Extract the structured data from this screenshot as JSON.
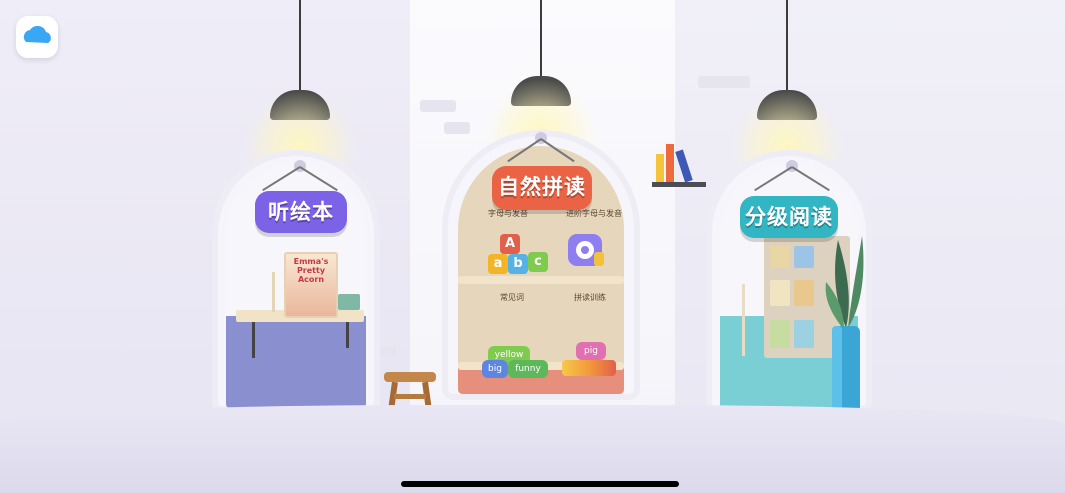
{
  "app_logo": {
    "icon": "cloud-icon",
    "color": "#3aa7f5"
  },
  "rooms": [
    {
      "sign_label": "听绘本",
      "sign_color": "#7c62e6",
      "floor_color": "#8a8fcf",
      "book": {
        "title": "Emma's Pretty Acorn"
      }
    },
    {
      "sign_label": "自然拼读",
      "sign_color": "#ea6345",
      "floor_color": "#e58f7c",
      "shelf_labels": [
        "字母与发音",
        "进阶字母与发音",
        "常见词",
        "拼读训练"
      ],
      "blocks": [
        "a",
        "b",
        "c",
        "A"
      ],
      "pills": [
        "yellow",
        "funny",
        "big",
        "pig"
      ]
    },
    {
      "sign_label": "分级阅读",
      "sign_color": "#33b6c4",
      "floor_color": "#79cfd3"
    }
  ],
  "decor": {
    "books_icon": "books-icon",
    "stool_icon": "stool-icon",
    "plant_icon": "plant-icon"
  }
}
